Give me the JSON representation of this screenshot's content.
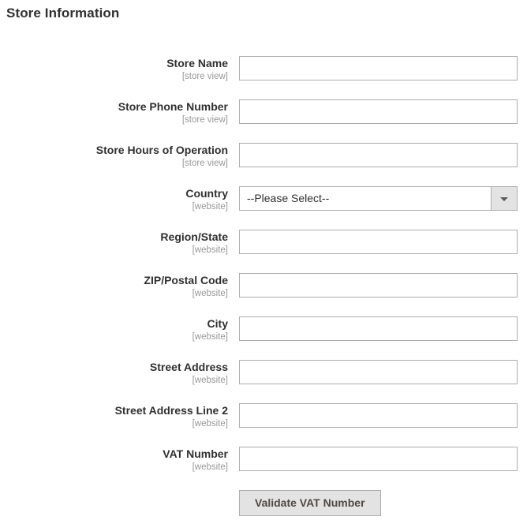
{
  "section": {
    "title": "Store Information"
  },
  "fields": [
    {
      "name": "store-name",
      "label": "Store Name",
      "scope": "[store view]",
      "type": "text",
      "value": "",
      "placeholder": ""
    },
    {
      "name": "store-phone-number",
      "label": "Store Phone Number",
      "scope": "[store view]",
      "type": "text",
      "value": "",
      "placeholder": ""
    },
    {
      "name": "store-hours-of-operation",
      "label": "Store Hours of Operation",
      "scope": "[store view]",
      "type": "text",
      "value": "",
      "placeholder": ""
    },
    {
      "name": "country",
      "label": "Country",
      "scope": "[website]",
      "type": "select",
      "value": "--Please Select--",
      "options": [
        "--Please Select--"
      ]
    },
    {
      "name": "region-state",
      "label": "Region/State",
      "scope": "[website]",
      "type": "text",
      "value": "",
      "placeholder": ""
    },
    {
      "name": "zip-postal-code",
      "label": "ZIP/Postal Code",
      "scope": "[website]",
      "type": "text",
      "value": "",
      "placeholder": ""
    },
    {
      "name": "city",
      "label": "City",
      "scope": "[website]",
      "type": "text",
      "value": "",
      "placeholder": ""
    },
    {
      "name": "street-address",
      "label": "Street Address",
      "scope": "[website]",
      "type": "text",
      "value": "",
      "placeholder": ""
    },
    {
      "name": "street-address-line-2",
      "label": "Street Address Line 2",
      "scope": "[website]",
      "type": "text",
      "value": "",
      "placeholder": ""
    },
    {
      "name": "vat-number",
      "label": "VAT Number",
      "scope": "[website]",
      "type": "text",
      "value": "",
      "placeholder": ""
    }
  ],
  "actions": {
    "validate_vat_label": "Validate VAT Number"
  },
  "icons": {
    "select_arrow": "chevron-down-icon"
  },
  "colors": {
    "heading_text": "#303030",
    "label_text": "#303030",
    "scope_text": "#989898",
    "input_border": "#adadad",
    "button_face": "#e3e3e3",
    "button_text": "#514943",
    "page_background": "#ffffff"
  }
}
